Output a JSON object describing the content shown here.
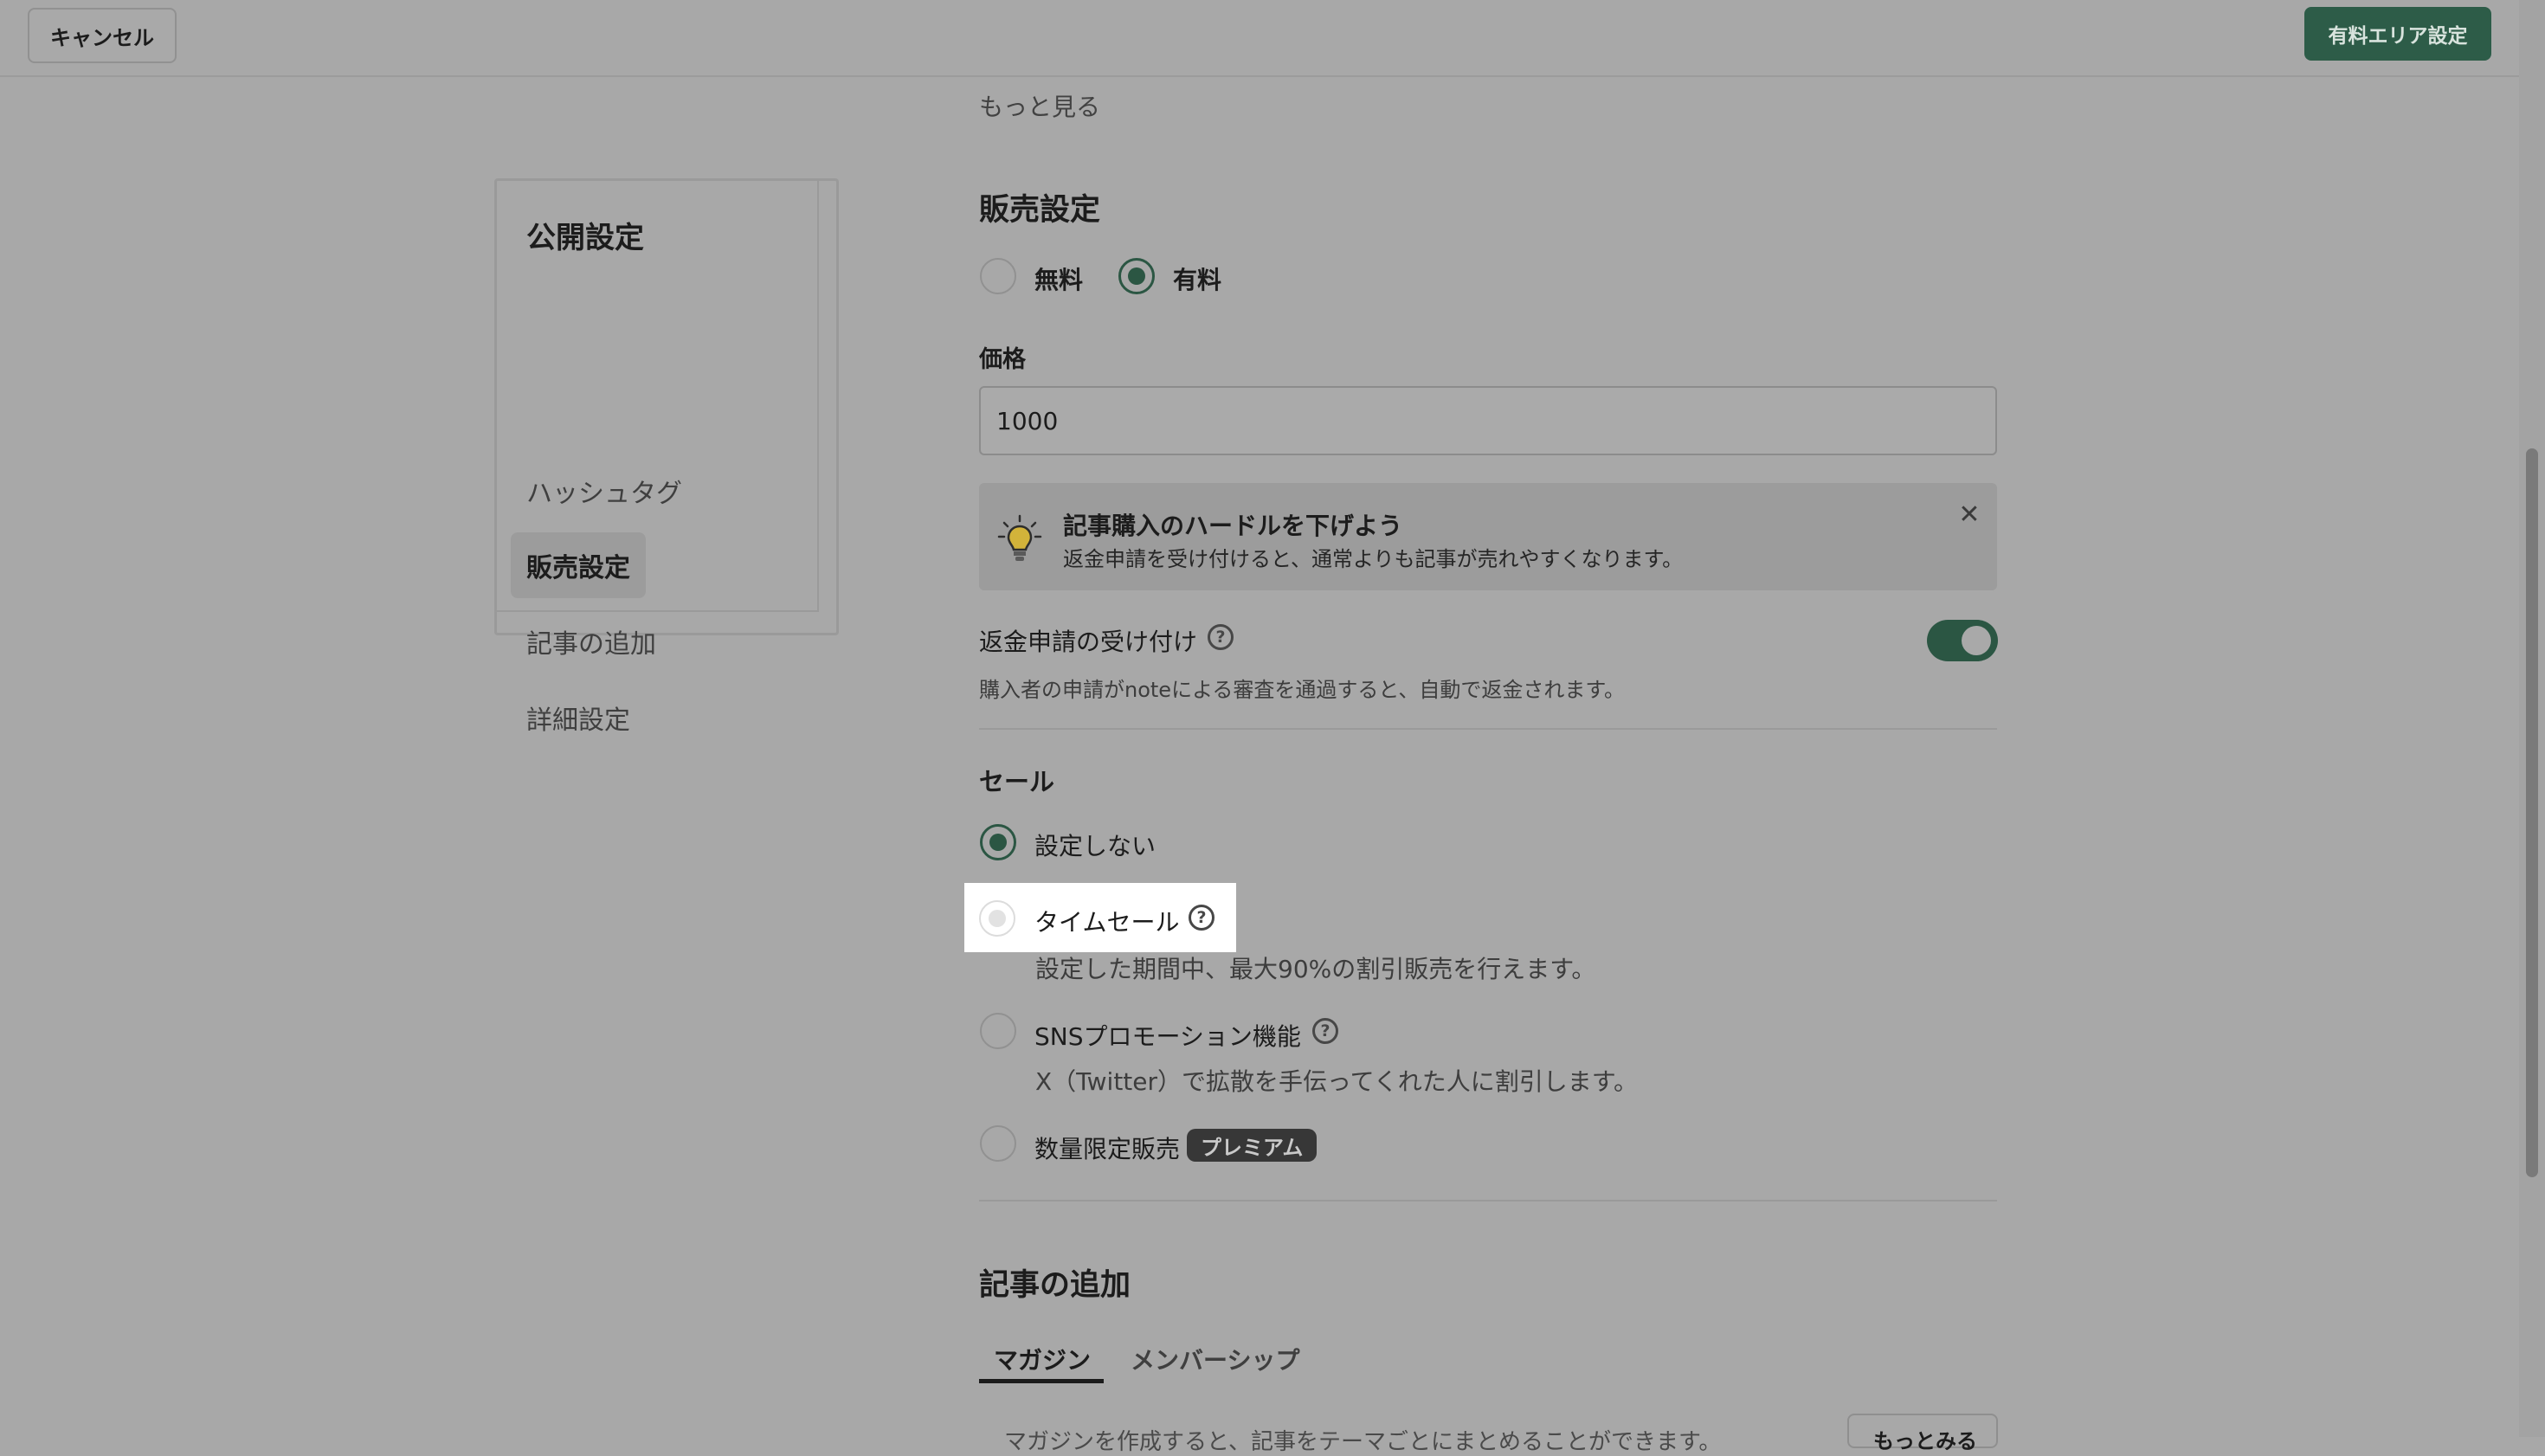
{
  "header": {
    "cancel_label": "キャンセル",
    "paid_area_label": "有料エリア設定"
  },
  "more_link": "もっと見る",
  "sidebar": {
    "title": "公開設定",
    "items": [
      {
        "label": "ハッシュタグ",
        "active": false
      },
      {
        "label": "販売設定",
        "active": true
      },
      {
        "label": "記事の追加",
        "active": false
      },
      {
        "label": "詳細設定",
        "active": false
      }
    ]
  },
  "sales": {
    "title": "販売設定",
    "options": [
      {
        "label": "無料",
        "checked": false
      },
      {
        "label": "有料",
        "checked": true
      }
    ],
    "price_label": "価格",
    "price_value": "1000",
    "tip": {
      "icon": "lightbulb-icon",
      "title": "記事購入のハードルを下げよう",
      "body": "返金申請を受け付けると、通常よりも記事が売れやすくなります。",
      "close_icon": "close-icon"
    },
    "refund": {
      "label": "返金申請の受け付け",
      "enabled": true,
      "description": "購入者の申請がnoteによる審査を通過すると、自動で返金されます。"
    }
  },
  "sale": {
    "title": "セール",
    "options": [
      {
        "label": "設定しない",
        "checked": true
      },
      {
        "label": "タイムセール",
        "checked": false,
        "description": "設定した期間中、最大90%の割引販売を行えます。"
      },
      {
        "label": "SNSプロモーション機能",
        "checked": false,
        "description": "X（Twitter）で拡散を手伝ってくれた人に割引します。"
      },
      {
        "label": "数量限定販売",
        "checked": false,
        "badge": "プレミアム"
      }
    ]
  },
  "add_article": {
    "title": "記事の追加",
    "tabs": [
      {
        "label": "マガジン",
        "active": true
      },
      {
        "label": "メンバーシップ",
        "active": false
      }
    ],
    "cut_text": "マガジンを作成すると、記事をテーマごとにまとめることができます。",
    "cut_button": "もっとみる"
  },
  "colors": {
    "accent": "#2b5643",
    "overlay": "#a8a8a8",
    "highlight": "#ffffff"
  }
}
